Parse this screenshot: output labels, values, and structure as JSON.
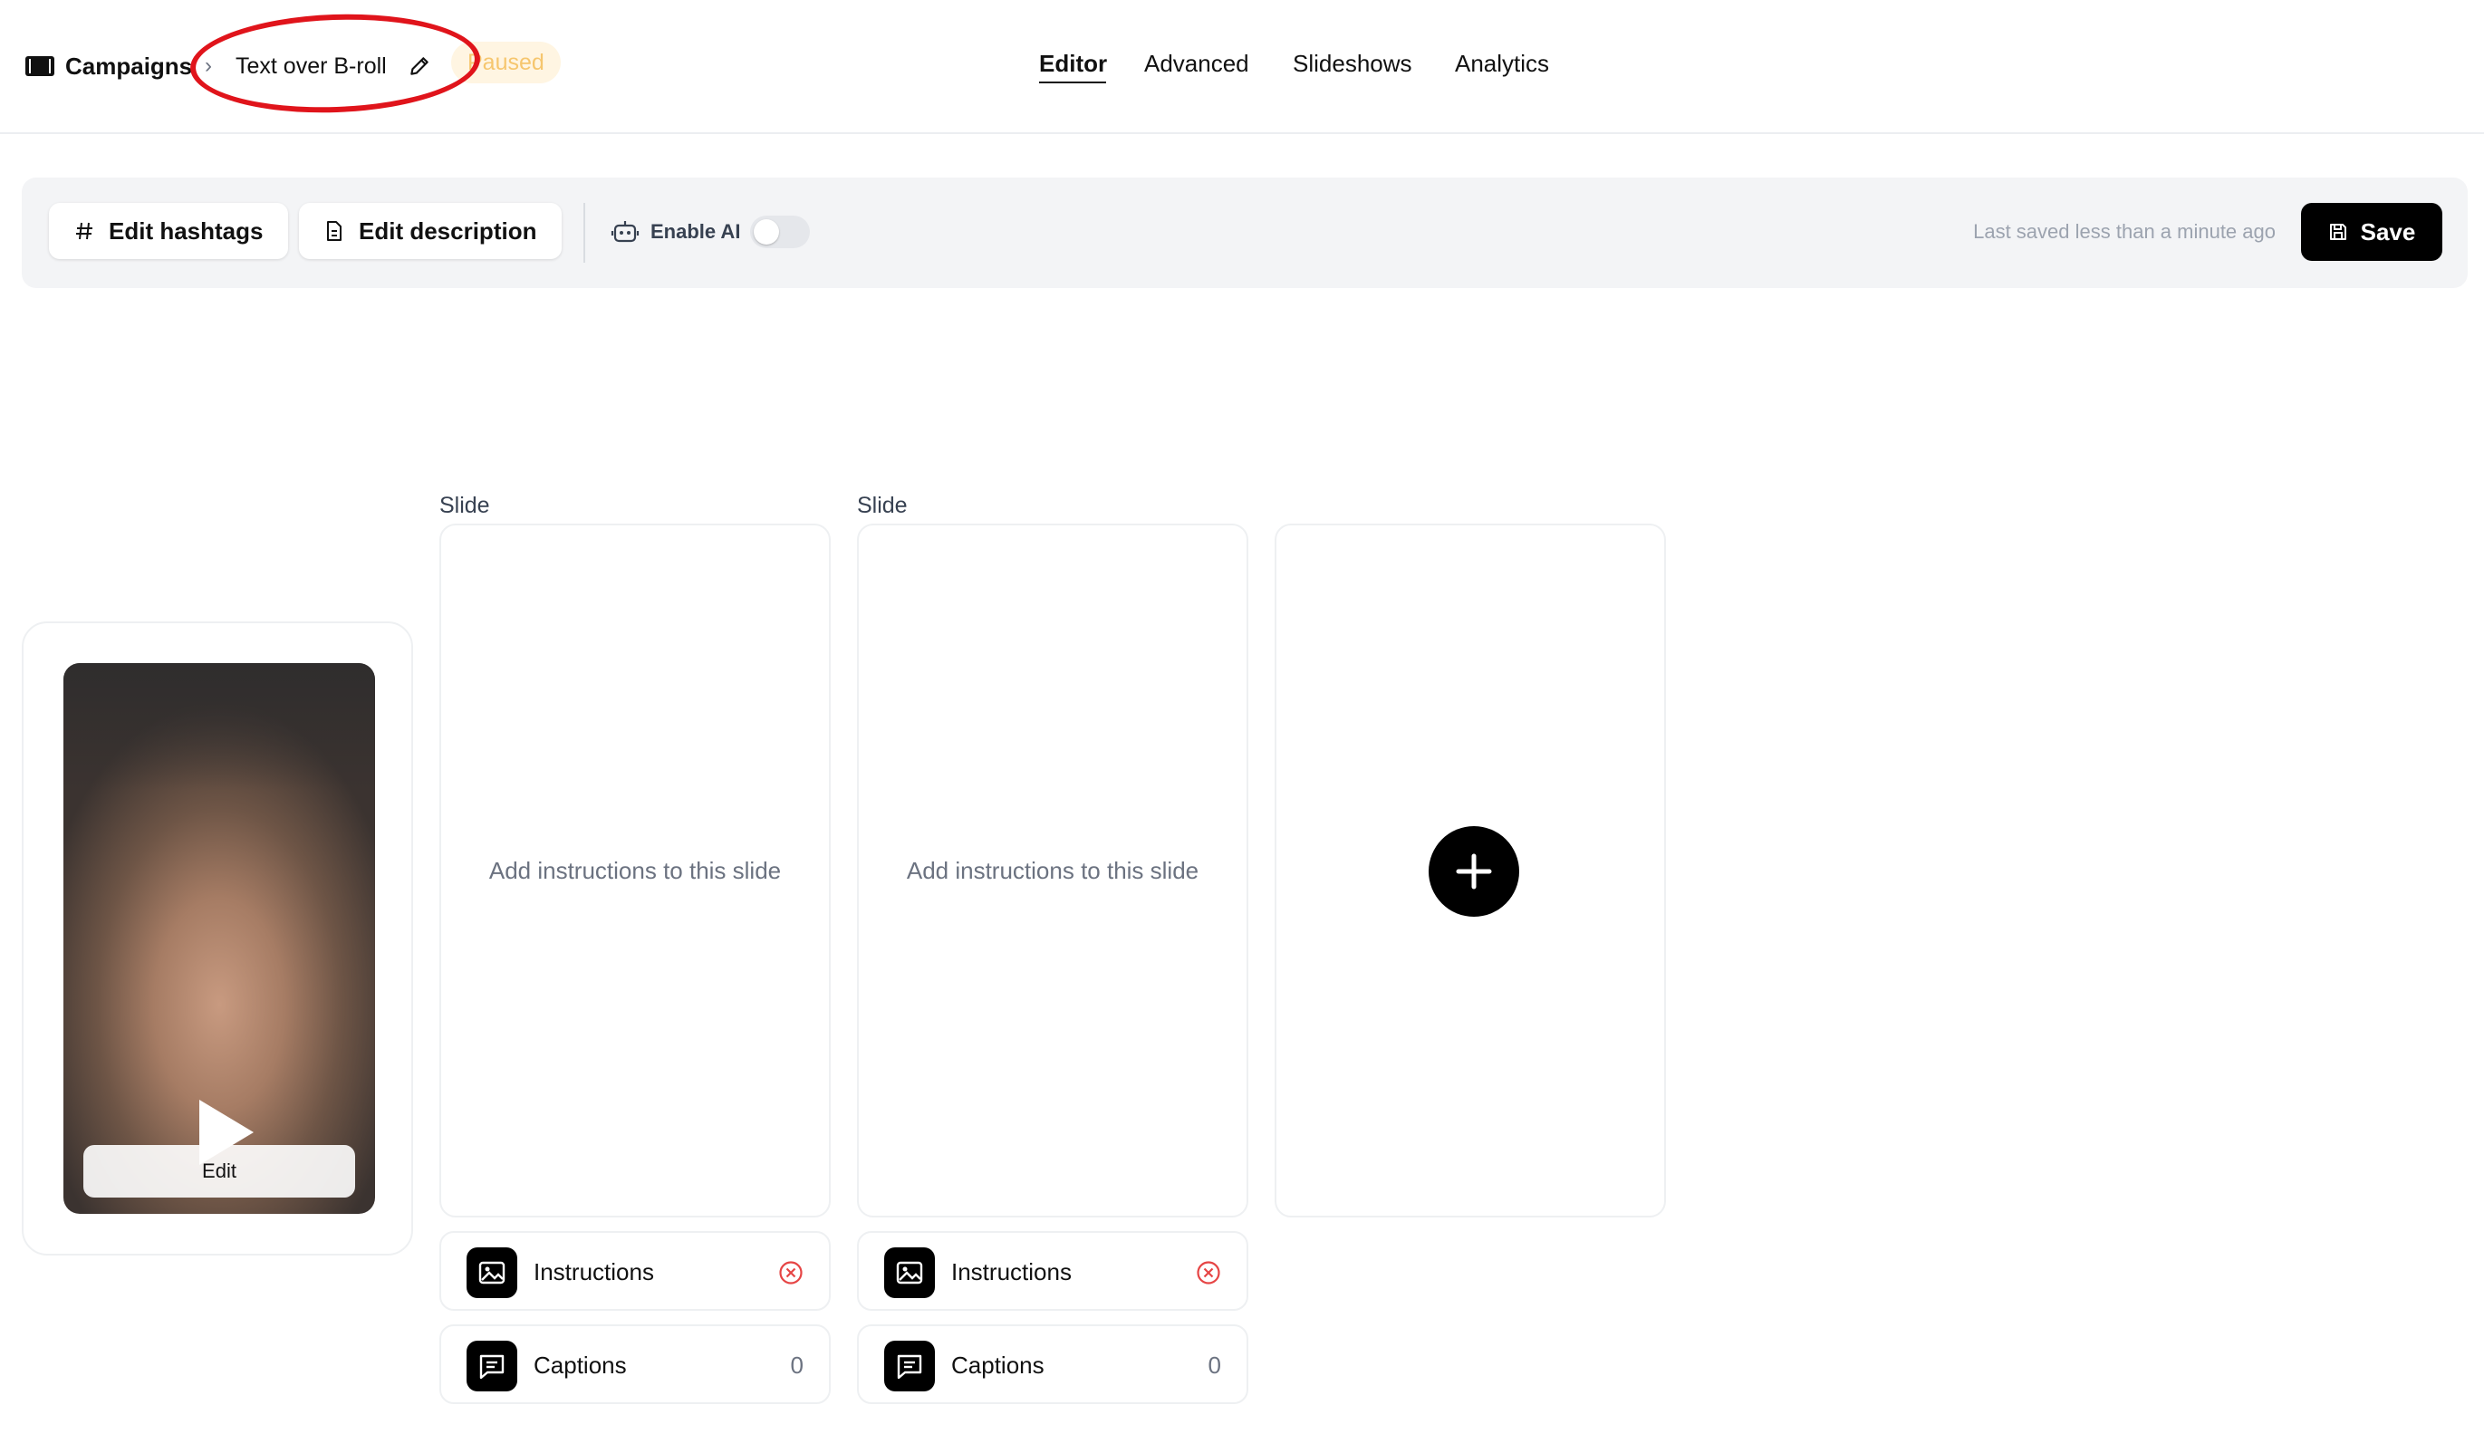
{
  "header": {
    "brand": "Campaigns",
    "breadcrumb_separator": "›",
    "campaign_name": "Text over B-roll",
    "status_badge": "Paused",
    "tabs": [
      {
        "label": "Editor",
        "active": true
      },
      {
        "label": "Advanced",
        "active": false
      },
      {
        "label": "Slideshows",
        "active": false
      },
      {
        "label": "Analytics",
        "active": false
      }
    ]
  },
  "toolbar": {
    "edit_hashtags": "Edit hashtags",
    "edit_description": "Edit description",
    "enable_ai": "Enable AI",
    "enable_ai_on": false,
    "last_saved": "Last saved less than a minute ago",
    "save": "Save"
  },
  "video": {
    "edit_label": "Edit"
  },
  "slides": [
    {
      "label": "Slide",
      "placeholder": "Add instructions to this slide",
      "instructions_label": "Instructions",
      "captions_label": "Captions",
      "captions_count": "0"
    },
    {
      "label": "Slide",
      "placeholder": "Add instructions to this slide",
      "instructions_label": "Instructions",
      "captions_label": "Captions",
      "captions_count": "0"
    }
  ],
  "colors": {
    "accent": "#000000",
    "annotation": "#e0141b",
    "badge_bg": "#fff5e2",
    "badge_text": "#f6c66e",
    "remove_icon": "#e64545"
  },
  "icons": [
    "film-icon",
    "chevron-right-icon",
    "pencil-icon",
    "hash-icon",
    "document-icon",
    "robot-icon",
    "save-icon",
    "play-icon",
    "image-icon",
    "message-icon",
    "remove-circle-icon",
    "plus-icon"
  ]
}
